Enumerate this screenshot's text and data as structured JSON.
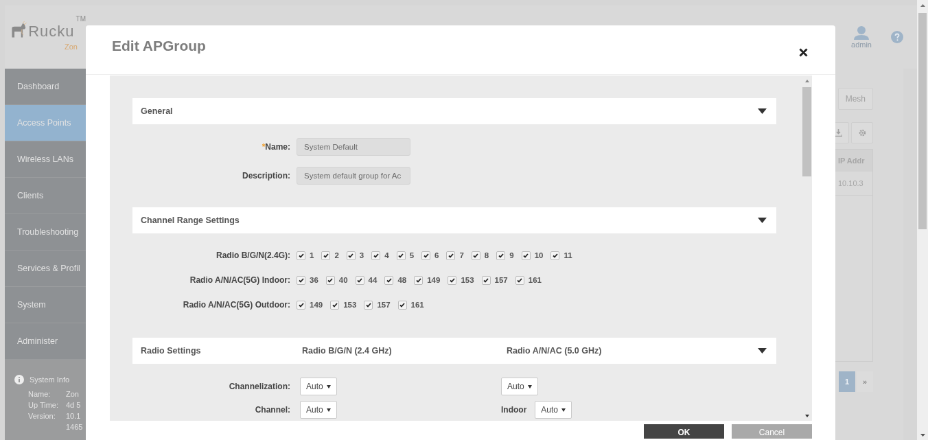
{
  "background": {
    "logo": {
      "name": "Rucku",
      "trademark": "TM",
      "product": "Zon"
    },
    "sidebar": {
      "items": [
        {
          "label": "Dashboard",
          "selected": false
        },
        {
          "label": "Access Points",
          "selected": true
        },
        {
          "label": "Wireless LANs",
          "selected": false
        },
        {
          "label": "Clients",
          "selected": false
        },
        {
          "label": "Troubleshooting",
          "selected": false
        },
        {
          "label": "Services & Profil",
          "selected": false
        },
        {
          "label": "System",
          "selected": false
        },
        {
          "label": "Administer",
          "selected": false
        }
      ],
      "system_info": {
        "title": "System Info",
        "rows": [
          {
            "label": "Name:",
            "values": [
              "Zon"
            ]
          },
          {
            "label": "Up Time:",
            "values": [
              "4d 5"
            ]
          },
          {
            "label": "Version:",
            "values": [
              "10.1",
              "1465"
            ]
          }
        ]
      }
    },
    "user": {
      "name": "admin"
    },
    "tab": "Mesh",
    "table": {
      "columns": [
        "IP Addr"
      ],
      "rows": [
        [
          "10.10.3"
        ]
      ]
    },
    "pagination": {
      "pages": [
        {
          "label": "1",
          "selected": true
        }
      ],
      "next": "»"
    }
  },
  "dialog": {
    "title": "Edit APGroup",
    "sections": [
      {
        "kind": "form",
        "title": "General",
        "fields": [
          {
            "required_mark": "*",
            "label": "Name:",
            "value": "System Default"
          },
          {
            "label": "Description:",
            "value": "System default group for Ac"
          }
        ]
      },
      {
        "kind": "channels",
        "title": "Channel Range Settings",
        "rows": [
          {
            "label": "Radio B/G/N(2.4G):",
            "channels": [
              {
                "number": "1",
                "checked": true
              },
              {
                "number": "2",
                "checked": true
              },
              {
                "number": "3",
                "checked": true
              },
              {
                "number": "4",
                "checked": true
              },
              {
                "number": "5",
                "checked": true
              },
              {
                "number": "6",
                "checked": true
              },
              {
                "number": "7",
                "checked": true
              },
              {
                "number": "8",
                "checked": true
              },
              {
                "number": "9",
                "checked": true
              },
              {
                "number": "10",
                "checked": true
              },
              {
                "number": "11",
                "checked": true
              }
            ]
          },
          {
            "label": "Radio A/N/AC(5G) Indoor:",
            "channels": [
              {
                "number": "36",
                "checked": true
              },
              {
                "number": "40",
                "checked": true
              },
              {
                "number": "44",
                "checked": true
              },
              {
                "number": "48",
                "checked": true
              },
              {
                "number": "149",
                "checked": true
              },
              {
                "number": "153",
                "checked": true
              },
              {
                "number": "157",
                "checked": true
              },
              {
                "number": "161",
                "checked": true
              }
            ]
          },
          {
            "label": "Radio A/N/AC(5G) Outdoor:",
            "channels": [
              {
                "number": "149",
                "checked": true
              },
              {
                "number": "153",
                "checked": true
              },
              {
                "number": "157",
                "checked": true
              },
              {
                "number": "161",
                "checked": true
              }
            ]
          }
        ]
      },
      {
        "kind": "radio",
        "title": "Radio Settings",
        "columns": [
          "Radio B/G/N (2.4 GHz)",
          "Radio A/N/AC (5.0 GHz)"
        ],
        "rows": [
          {
            "label": "Channelization:",
            "cells": [
              {
                "value": "Auto"
              },
              {
                "value": "Auto"
              }
            ]
          },
          {
            "label": "Channel:",
            "cells": [
              {
                "value": "Auto"
              },
              {
                "label": "Indoor",
                "value": "Auto"
              }
            ]
          }
        ]
      }
    ],
    "buttons": [
      {
        "label": "OK",
        "kind": "primary"
      },
      {
        "label": "Cancel",
        "kind": "secondary"
      }
    ]
  }
}
